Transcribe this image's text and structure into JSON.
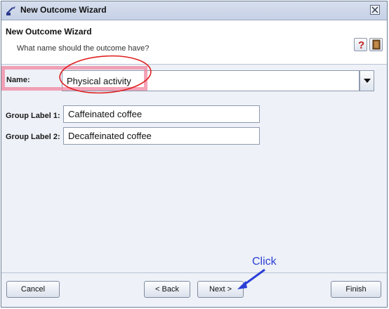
{
  "window": {
    "title": "New Outcome Wizard",
    "icons": {
      "app": "wizard-icon",
      "close": "close-icon"
    }
  },
  "header": {
    "title": "New Outcome Wizard",
    "subtitle": "What name should the outcome have?",
    "icons": [
      "help-icon",
      "notebook-icon"
    ]
  },
  "form": {
    "name_label": "Name:",
    "name_value": "Physical activity",
    "group1_label": "Group Label 1:",
    "group1_value": "Caffeinated coffee",
    "group2_label": "Group Label 2:",
    "group2_value": "Decaffeinated coffee"
  },
  "buttons": {
    "cancel": "Cancel",
    "back": "< Back",
    "next": "Next >",
    "finish": "Finish"
  },
  "annotation": {
    "click_text": "Click",
    "highlight_color": "#f084a0",
    "circle_color": "#e02020",
    "arrow_color": "#2a3fd6"
  }
}
